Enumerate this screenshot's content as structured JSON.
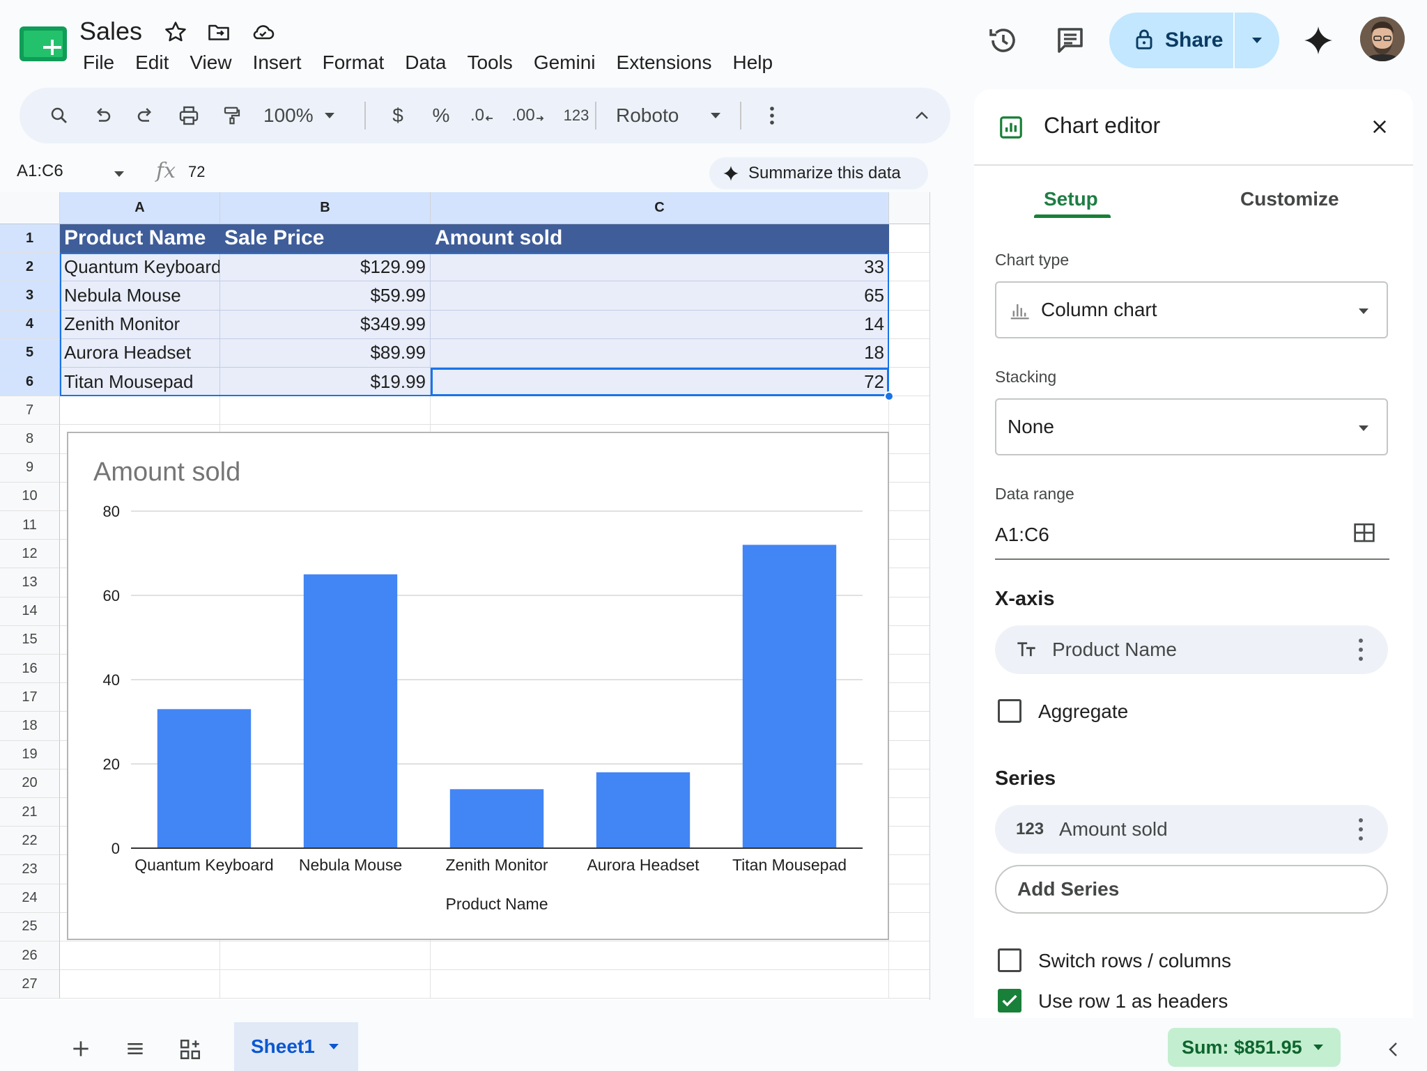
{
  "app": {
    "doc_title": "Sales",
    "menu": [
      "File",
      "Edit",
      "View",
      "Insert",
      "Format",
      "Data",
      "Tools",
      "Gemini",
      "Extensions",
      "Help"
    ],
    "share_label": "Share"
  },
  "toolbar": {
    "zoom": "100%",
    "currency": "$",
    "percent": "%",
    "decimal_decrease": ".0",
    "decimal_increase": ".00",
    "number_format": "123",
    "font": "Roboto"
  },
  "formula_bar": {
    "name_box": "A1:C6",
    "fx": "fx",
    "value": "72",
    "summarize_label": "Summarize this data"
  },
  "sheet": {
    "columns": [
      "A",
      "B",
      "C"
    ],
    "rows": [
      "1",
      "2",
      "3",
      "4",
      "5",
      "6",
      "7",
      "8",
      "9",
      "10",
      "11",
      "12",
      "13",
      "14",
      "15",
      "16",
      "17",
      "18",
      "19",
      "20",
      "21",
      "22",
      "23",
      "24",
      "25",
      "26",
      "27"
    ],
    "headers": [
      "Product Name",
      "Sale Price",
      "Amount sold"
    ],
    "data": [
      [
        "Quantum Keyboard",
        "$129.99",
        "33"
      ],
      [
        "Nebula Mouse",
        "$59.99",
        "65"
      ],
      [
        "Zenith Monitor",
        "$349.99",
        "14"
      ],
      [
        "Aurora Headset",
        "$89.99",
        "18"
      ],
      [
        "Titan Mousepad",
        "$19.99",
        "72"
      ]
    ]
  },
  "chart_data": {
    "type": "bar",
    "title": "Amount sold",
    "categories": [
      "Quantum Keyboard",
      "Nebula Mouse",
      "Zenith Monitor",
      "Aurora Headset",
      "Titan Mousepad"
    ],
    "values": [
      33,
      65,
      14,
      18,
      72
    ],
    "xlabel": "Product Name",
    "ylabel": "",
    "ylim": [
      0,
      80
    ],
    "yticks": [
      "0",
      "20",
      "40",
      "60",
      "80"
    ],
    "grid": true,
    "bar_color": "#4285f4"
  },
  "bottom": {
    "sheet_tab": "Sheet1",
    "sum": "Sum: $851.95"
  },
  "editor": {
    "title": "Chart editor",
    "tabs": [
      "Setup",
      "Customize"
    ],
    "chart_type_label": "Chart type",
    "chart_type_value": "Column chart",
    "stacking_label": "Stacking",
    "stacking_value": "None",
    "data_range_label": "Data range",
    "data_range_value": "A1:C6",
    "x_axis_title": "X-axis",
    "x_axis_value": "Product Name",
    "aggregate_label": "Aggregate",
    "series_title": "Series",
    "series_value": "Amount sold",
    "add_series_label": "Add Series",
    "switch_label": "Switch rows / columns",
    "headers_label": "Use row 1 as headers"
  },
  "colors": {
    "header_fill": "#3f5d99",
    "band_fill": "#e8edf9",
    "accent_green": "#188038",
    "share_fill": "#c2e7ff"
  }
}
